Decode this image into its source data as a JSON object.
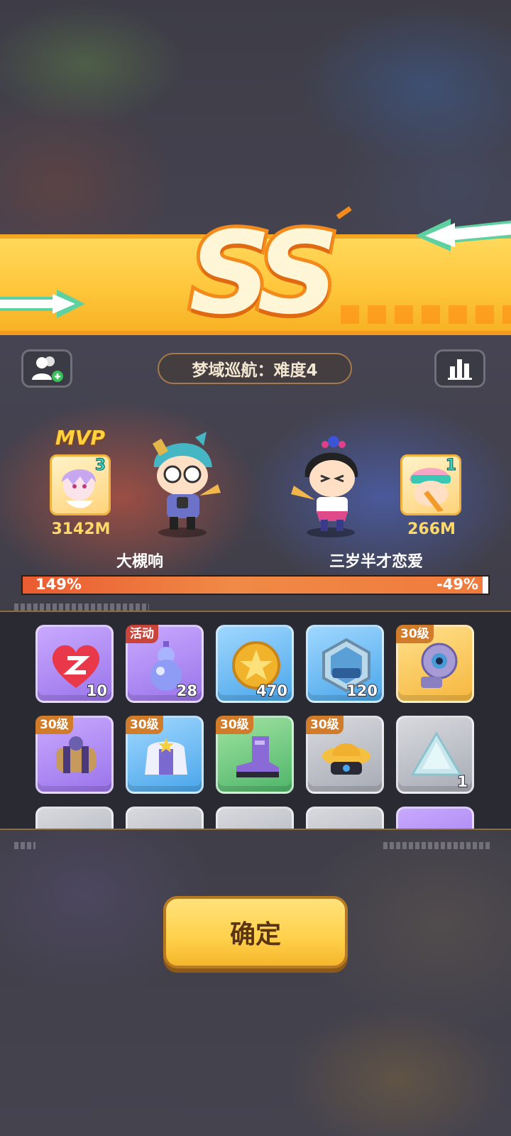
{
  "result": {
    "grade": "SS",
    "stage": "梦域巡航：难度4"
  },
  "buttons": {
    "add_friend_icon": "add-friend-icon",
    "stats_icon": "bar-chart-icon",
    "confirm_label": "确定"
  },
  "players": [
    {
      "name": "大槻响",
      "score": "3142M",
      "card_level": "3",
      "mvp_label": "MVP"
    },
    {
      "name": "三岁半才恋爱",
      "score": "266M",
      "card_level": "1"
    }
  ],
  "comparison": {
    "left_percent": "149%",
    "right_percent": "-49%",
    "left_share": 0.988
  },
  "rewards": [
    {
      "name": "heart-z-icon",
      "color": "purple",
      "quantity": "10",
      "tag": ""
    },
    {
      "name": "gourd-icon",
      "color": "purple",
      "quantity": "28",
      "tag": "活动"
    },
    {
      "name": "star-coin-icon",
      "color": "blue",
      "quantity": "470",
      "tag": ""
    },
    {
      "name": "exp-badge-icon",
      "color": "blue",
      "quantity": "120",
      "tag": ""
    },
    {
      "name": "eye-gauntlet-icon",
      "color": "gold",
      "quantity": "",
      "tag": "30级"
    },
    {
      "name": "barrel-icon",
      "color": "purple",
      "quantity": "",
      "tag": "30级"
    },
    {
      "name": "jacket-icon",
      "color": "blue",
      "quantity": "",
      "tag": "30级"
    },
    {
      "name": "boot-icon",
      "color": "green",
      "quantity": "",
      "tag": "30级"
    },
    {
      "name": "duck-helmet-icon",
      "color": "gray",
      "quantity": "",
      "tag": "30级"
    },
    {
      "name": "crystal-icon",
      "color": "gray",
      "quantity": "1",
      "tag": ""
    }
  ]
}
